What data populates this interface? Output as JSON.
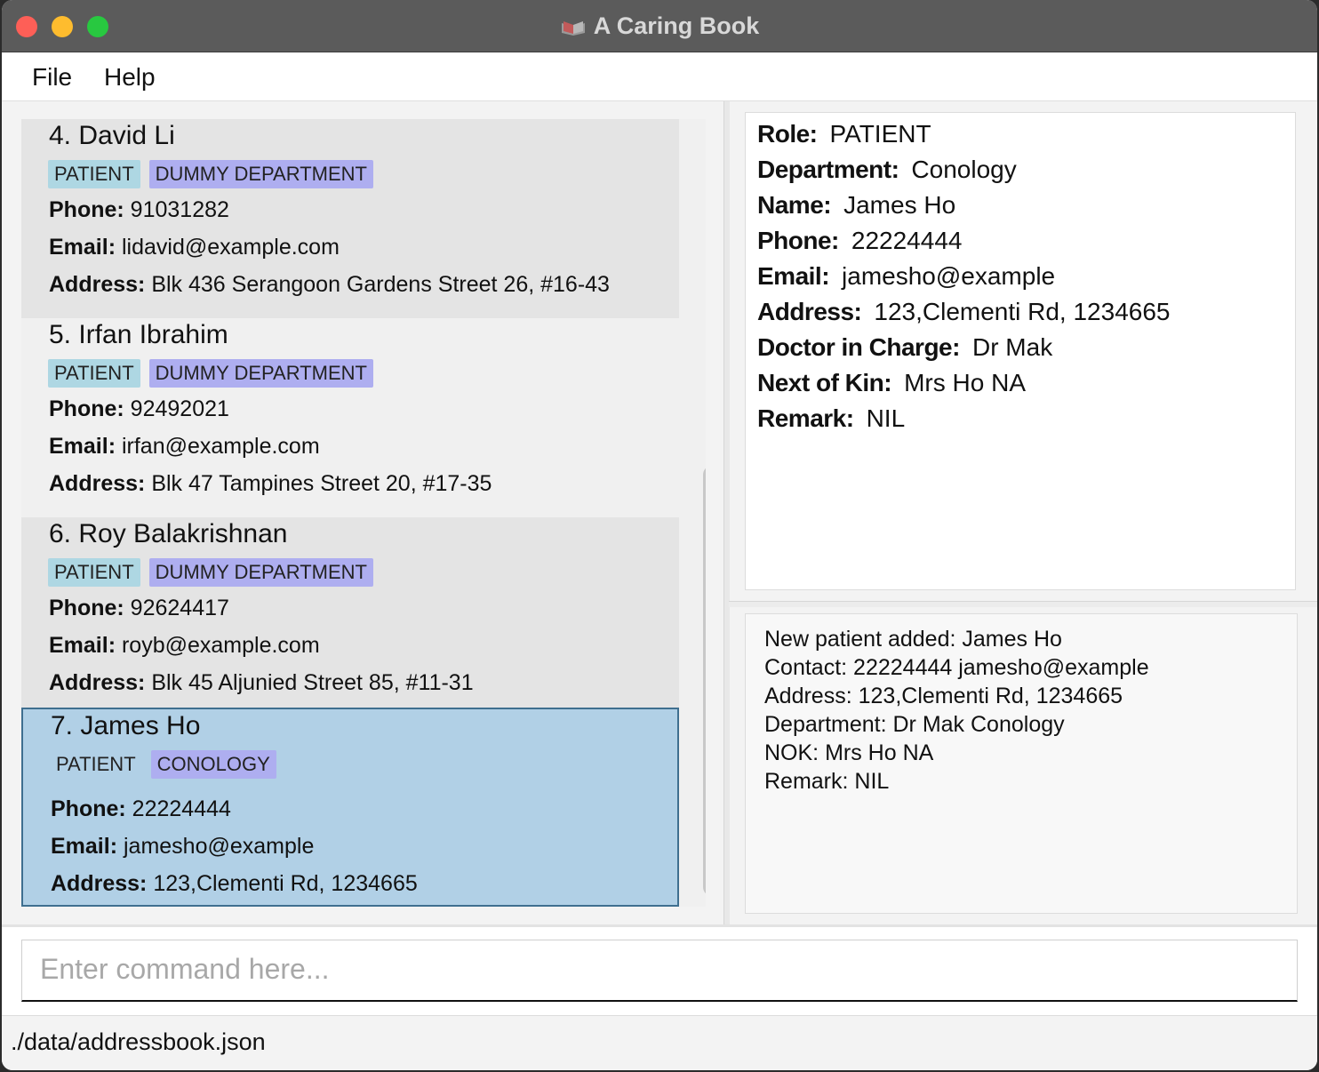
{
  "window": {
    "title": "A Caring Book",
    "icon": "book-icon"
  },
  "menu": {
    "file": "File",
    "help": "Help"
  },
  "persons": [
    {
      "name": "4. David Li",
      "role": "PATIENT",
      "department": "DUMMY DEPARTMENT",
      "phone_label": "Phone:",
      "phone": "91031282",
      "email_label": "Email:",
      "email": "lidavid@example.com",
      "address_label": "Address:",
      "address": "Blk 436 Serangoon Gardens Street 26, #16-43"
    },
    {
      "name": "5. Irfan Ibrahim",
      "role": "PATIENT",
      "department": "DUMMY DEPARTMENT",
      "phone_label": "Phone:",
      "phone": "92492021",
      "email_label": "Email:",
      "email": "irfan@example.com",
      "address_label": "Address:",
      "address": "Blk 47 Tampines Street 20, #17-35"
    },
    {
      "name": "6. Roy Balakrishnan",
      "role": "PATIENT",
      "department": "DUMMY DEPARTMENT",
      "phone_label": "Phone:",
      "phone": "92624417",
      "email_label": "Email:",
      "email": "royb@example.com",
      "address_label": "Address:",
      "address": "Blk 45 Aljunied Street 85, #11-31"
    },
    {
      "name": "7. James Ho",
      "role": "PATIENT",
      "department": "CONOLOGY",
      "phone_label": "Phone:",
      "phone": "22224444",
      "email_label": "Email:",
      "email": "jamesho@example",
      "address_label": "Address:",
      "address": "123,Clementi Rd, 1234665",
      "selected": true
    }
  ],
  "detail": {
    "role_label": "Role:",
    "role": "PATIENT",
    "department_label": "Department:",
    "department": "Conology",
    "name_label": "Name:",
    "name": "James Ho",
    "phone_label": "Phone:",
    "phone": "22224444",
    "email_label": "Email:",
    "email": "jamesho@example",
    "address_label": "Address:",
    "address": "123,Clementi Rd, 1234665",
    "doctor_label": "Doctor in Charge:",
    "doctor": "Dr Mak",
    "nok_label": "Next of Kin:",
    "nok": "Mrs Ho NA",
    "remark_label": "Remark:",
    "remark": "NIL"
  },
  "result": {
    "lines": [
      "New patient added: James Ho",
      "Contact: 22224444 jamesho@example",
      "Address: 123,Clementi Rd, 1234665",
      "Department: Dr Mak Conology",
      "NOK: Mrs Ho NA",
      "Remark: NIL"
    ]
  },
  "command": {
    "placeholder": "Enter command here...",
    "value": ""
  },
  "status": {
    "file_path": "./data/addressbook.json"
  },
  "colors": {
    "role_tag": "#aed7e3",
    "department_tag": "#aeaef0",
    "selected_card": "#b1d0e6"
  }
}
